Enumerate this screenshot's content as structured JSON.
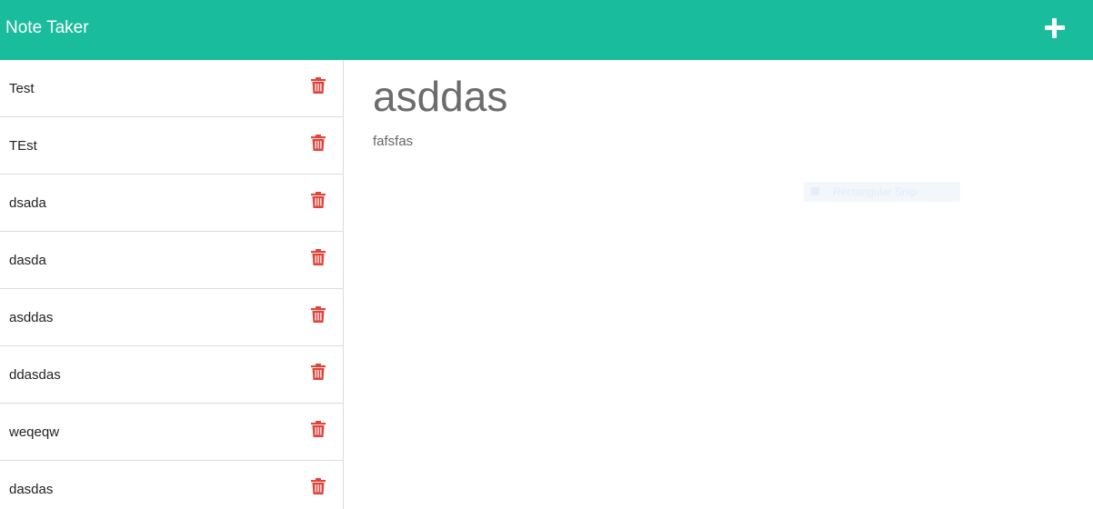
{
  "app": {
    "title": "Note Taker",
    "add_icon": "plus-icon",
    "accent_color": "#19bc9c",
    "delete_color": "#e0443b"
  },
  "notes": [
    {
      "title": "Test"
    },
    {
      "title": "TEst"
    },
    {
      "title": "dsada"
    },
    {
      "title": "dasda"
    },
    {
      "title": "asddas"
    },
    {
      "title": "ddasdas"
    },
    {
      "title": "weqeqw"
    },
    {
      "title": "dasdas"
    }
  ],
  "active_note": {
    "title": "asddas",
    "text": "fafsfas"
  },
  "overlay": {
    "label": "Rectangular Snip"
  }
}
